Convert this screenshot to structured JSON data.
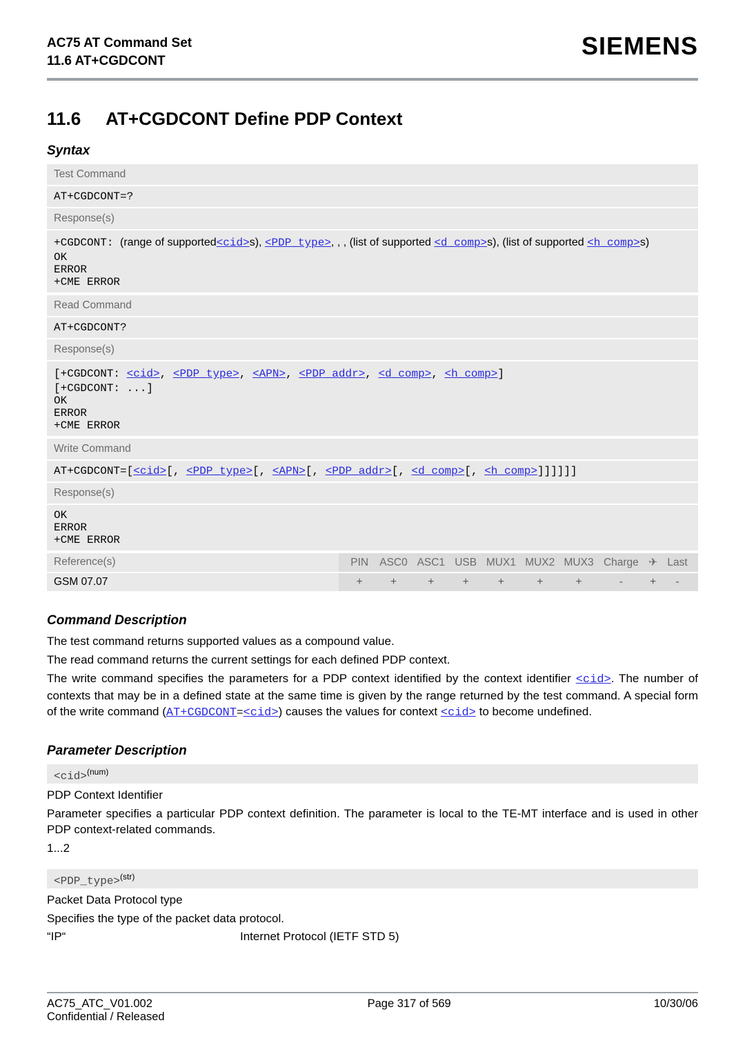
{
  "header": {
    "product": "AC75 AT Command Set",
    "section_ref": "11.6 AT+CGDCONT",
    "logo": "SIEMENS"
  },
  "section": {
    "number": "11.6",
    "title": "AT+CGDCONT   Define PDP Context"
  },
  "syntax_label": "Syntax",
  "test_cmd": {
    "label": "Test Command",
    "cmd": "AT+CGDCONT=?",
    "resp_label": "Response(s)",
    "resp_prefix": "+CGDCONT: ",
    "resp_text1": "(range of supported",
    "resp_cid": "<cid>",
    "resp_text2": "s), ",
    "resp_pdp": "<PDP_type>",
    "resp_text3": ", , , (list of supported ",
    "resp_d": "<d_comp>",
    "resp_text4": "s), (list of supported ",
    "resp_h": "<h_comp>",
    "resp_text5": "s)",
    "resp_lines": [
      "OK",
      "ERROR",
      "+CME ERROR"
    ]
  },
  "read_cmd": {
    "label": "Read Command",
    "cmd": "AT+CGDCONT?",
    "resp_label": "Response(s)",
    "line1_open": "[",
    "line1_pref": "+CGDCONT: ",
    "cid": "<cid>",
    "c1": ", ",
    "pdp": "<PDP_type>",
    "c2": ", ",
    "apn": "<APN>",
    "c3": ", ",
    "addr": "<PDP_addr>",
    "c4": ", ",
    "dcomp": "<d_comp>",
    "c5": ", ",
    "hcomp": "<h_comp>",
    "line1_close": "]",
    "line2": "[+CGDCONT: ...]",
    "resp_lines": [
      "OK",
      "ERROR",
      "+CME ERROR"
    ]
  },
  "write_cmd": {
    "label": "Write Command",
    "pref": "AT+CGDCONT=",
    "open": "[",
    "cid": "<cid>",
    "sep": "[, ",
    "pdp": "<PDP_type>",
    "apn": "<APN>",
    "addr": "<PDP_addr>",
    "dcomp": "<d_comp>",
    "hcomp": "<h_comp>",
    "close": "]]]]]]",
    "resp_label": "Response(s)",
    "resp_lines": [
      "OK",
      "ERROR",
      "+CME ERROR"
    ]
  },
  "ref_table": {
    "ref_label": "Reference(s)",
    "cols": [
      "PIN",
      "ASC0",
      "ASC1",
      "USB",
      "MUX1",
      "MUX2",
      "MUX3",
      "Charge",
      "✈",
      "Last"
    ],
    "row_name": "GSM 07.07",
    "row_vals": [
      "+",
      "+",
      "+",
      "+",
      "+",
      "+",
      "+",
      "-",
      "+",
      "-"
    ]
  },
  "cmd_desc": {
    "heading": "Command Description",
    "p1": "The test command returns supported values as a compound value.",
    "p2": "The read command returns the current settings for each defined PDP context.",
    "p3a": "The write command specifies the parameters for a PDP context identified by the context identifier ",
    "p3_cid": "<cid>",
    "p3b": ". The number of contexts that may be in a defined state at the same time is given by the range returned by the test command. A special form of the write command (",
    "p3_cmd": "AT+CGDCONT",
    "p3_eq": "=",
    "p3_cid2": "<cid>",
    "p3c": ") causes the values for context ",
    "p3_cid3": "<cid>",
    "p3d": " to become undefined."
  },
  "param_desc": {
    "heading": "Parameter Description",
    "cid_tag": "<cid>",
    "cid_sup": "(num)",
    "cid_title": "PDP Context Identifier",
    "cid_body": "Parameter specifies a particular PDP context definition. The parameter is local to the TE-MT interface and is used in other PDP context-related commands.",
    "cid_range": "1...2",
    "pdp_tag": "<PDP_type>",
    "pdp_sup": "(str)",
    "pdp_title": "Packet Data Protocol type",
    "pdp_subtitle": "Specifies the type of the packet data protocol.",
    "pdp_val": "“IP“",
    "pdp_val_desc": "Internet Protocol (IETF STD 5)"
  },
  "footer": {
    "left": "AC75_ATC_V01.002",
    "left2": "Confidential / Released",
    "center": "Page 317 of 569",
    "right": "10/30/06"
  }
}
